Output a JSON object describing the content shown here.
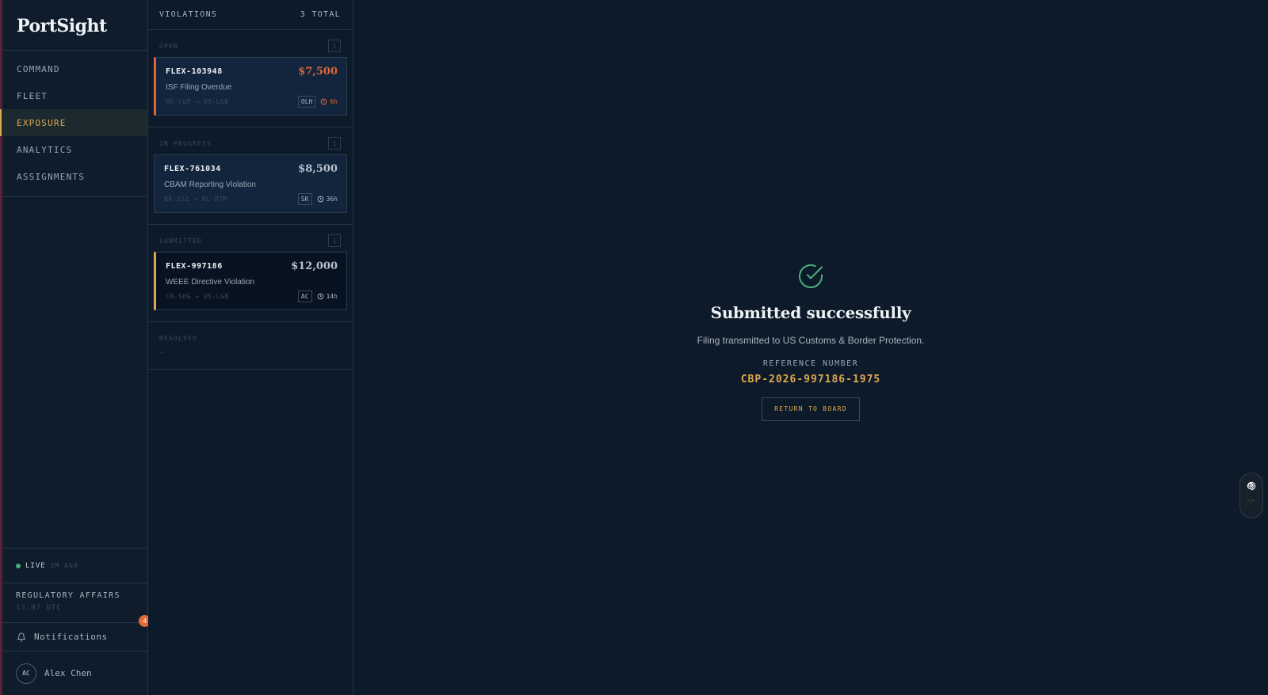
{
  "brand": {
    "name": "PortSight"
  },
  "nav": [
    {
      "label": "COMMAND",
      "active": false
    },
    {
      "label": "FLEET",
      "active": false
    },
    {
      "label": "EXPOSURE",
      "active": true
    },
    {
      "label": "ANALYTICS",
      "active": false
    },
    {
      "label": "ASSIGNMENTS",
      "active": false
    }
  ],
  "status": {
    "live_label": "LIVE",
    "ago": "2M AGO"
  },
  "team": {
    "name": "REGULATORY AFFAIRS",
    "time": "13:07 UTC"
  },
  "notifications": {
    "label": "Notifications",
    "count": "4"
  },
  "user": {
    "initials": "AC",
    "name": "Alex Chen"
  },
  "violations": {
    "title": "VIOLATIONS",
    "total": "3 TOTAL",
    "sections": [
      {
        "title": "OPEN",
        "count": "1",
        "card": {
          "id": "FLEX-103948",
          "amount": "$7,500",
          "title": "ISF Filing Overdue",
          "route": "BD-CGP → US-LGB",
          "tag": "OLH",
          "time": "6h"
        }
      },
      {
        "title": "IN PROGRESS",
        "count": "1",
        "card": {
          "id": "FLEX-761034",
          "amount": "$8,500",
          "title": "CBAM Reporting Violation",
          "route": "BR-SSZ → NL-RTM",
          "tag": "SK",
          "time": "36h"
        }
      },
      {
        "title": "SUBMITTED",
        "count": "1",
        "card": {
          "id": "FLEX-997186",
          "amount": "$12,000",
          "title": "WEEE Directive Violation",
          "route": "CN-SHG → US-LGB",
          "tag": "AC",
          "time": "14h"
        }
      },
      {
        "title": "RESOLVED",
        "empty": "—"
      }
    ]
  },
  "success": {
    "title": "Submitted successfully",
    "subtitle": "Filing transmitted to US Customs & Border Protection.",
    "ref_label": "REFERENCE NUMBER",
    "ref_number": "CBP-2026-997186-1975",
    "button": "RETURN TO BOARD"
  },
  "colors": {
    "accent": "#e0a84e",
    "alert": "#e0673a",
    "success": "#4caf7a",
    "background": "#0c1a2a"
  },
  "icons": {
    "check": "check-circle-icon",
    "bell": "bell-icon",
    "clock": "clock-icon",
    "widget": "spiral-icon"
  }
}
